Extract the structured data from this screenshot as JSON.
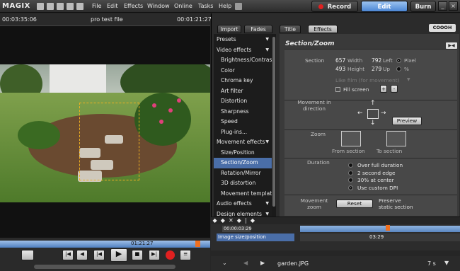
{
  "app": {
    "logo": "MAGIX"
  },
  "menu": [
    "File",
    "Edit",
    "Effects",
    "Window",
    "Online",
    "Tasks",
    "Help"
  ],
  "modes": {
    "record": "Record",
    "edit": "Edit",
    "burn": "Burn"
  },
  "preview": {
    "time_left": "00:03:35:06",
    "title": "pro test file",
    "time_right": "00:01:21:27"
  },
  "transport": {
    "position": "01:21:27"
  },
  "tabs": [
    "Import",
    "Fades",
    "Title",
    "Effects"
  ],
  "brand": "COOOH",
  "effects_list": [
    {
      "label": "Presets",
      "type": "group"
    },
    {
      "label": "Video effects",
      "type": "group"
    },
    {
      "label": "Brightness/Contrast",
      "type": "sub"
    },
    {
      "label": "Color",
      "type": "sub"
    },
    {
      "label": "Chroma key",
      "type": "sub"
    },
    {
      "label": "Art filter",
      "type": "sub"
    },
    {
      "label": "Distortion",
      "type": "sub"
    },
    {
      "label": "Sharpness",
      "type": "sub"
    },
    {
      "label": "Speed",
      "type": "sub"
    },
    {
      "label": "Plug-ins...",
      "type": "sub"
    },
    {
      "label": "Movement effects",
      "type": "group"
    },
    {
      "label": "Size/Position",
      "type": "sub"
    },
    {
      "label": "Section/Zoom",
      "type": "sub",
      "selected": true
    },
    {
      "label": "Rotation/Mirror",
      "type": "sub"
    },
    {
      "label": "3D distortion",
      "type": "sub"
    },
    {
      "label": "Movement template",
      "type": "sub"
    },
    {
      "label": "Audio effects",
      "type": "group"
    },
    {
      "label": "Design elements",
      "type": "group"
    }
  ],
  "panel": {
    "title": "Section/Zoom",
    "section": {
      "label": "Section",
      "width_val": "657",
      "width_lbl": "Width",
      "left_val": "792",
      "left_lbl": "Left",
      "height_val": "493",
      "height_lbl": "Height",
      "up_val": "279",
      "up_lbl": "Up",
      "unit_pixel": "Pixel",
      "unit_percent": "%",
      "unit_selected": "pixel",
      "like_film": "Like film (for movement)",
      "fill_screen": "Fill screen",
      "plus": "+",
      "minus": "-"
    },
    "movement": {
      "label": "Movement in direction",
      "preview": "Preview"
    },
    "zoom": {
      "label": "Zoom",
      "from": "From section",
      "to": "To section"
    },
    "duration": {
      "label": "Duration",
      "options": [
        "Over full duration",
        "2 second edge",
        "30% at center",
        "Use custom DPI"
      ],
      "selected": 3
    },
    "movement_zoom": {
      "label": "Movement zoom",
      "reset": "Reset",
      "preserve": "Preserve static section"
    }
  },
  "timeline": {
    "time": "00:00:03:29",
    "track": "Image size/position",
    "keyframe_time": "03:29"
  },
  "bottom": {
    "filename": "garden.JPG",
    "duration": "7 s"
  },
  "colors": {
    "accent": "#4b86d4",
    "record": "#e02020",
    "selection": "#4a6ea8"
  }
}
